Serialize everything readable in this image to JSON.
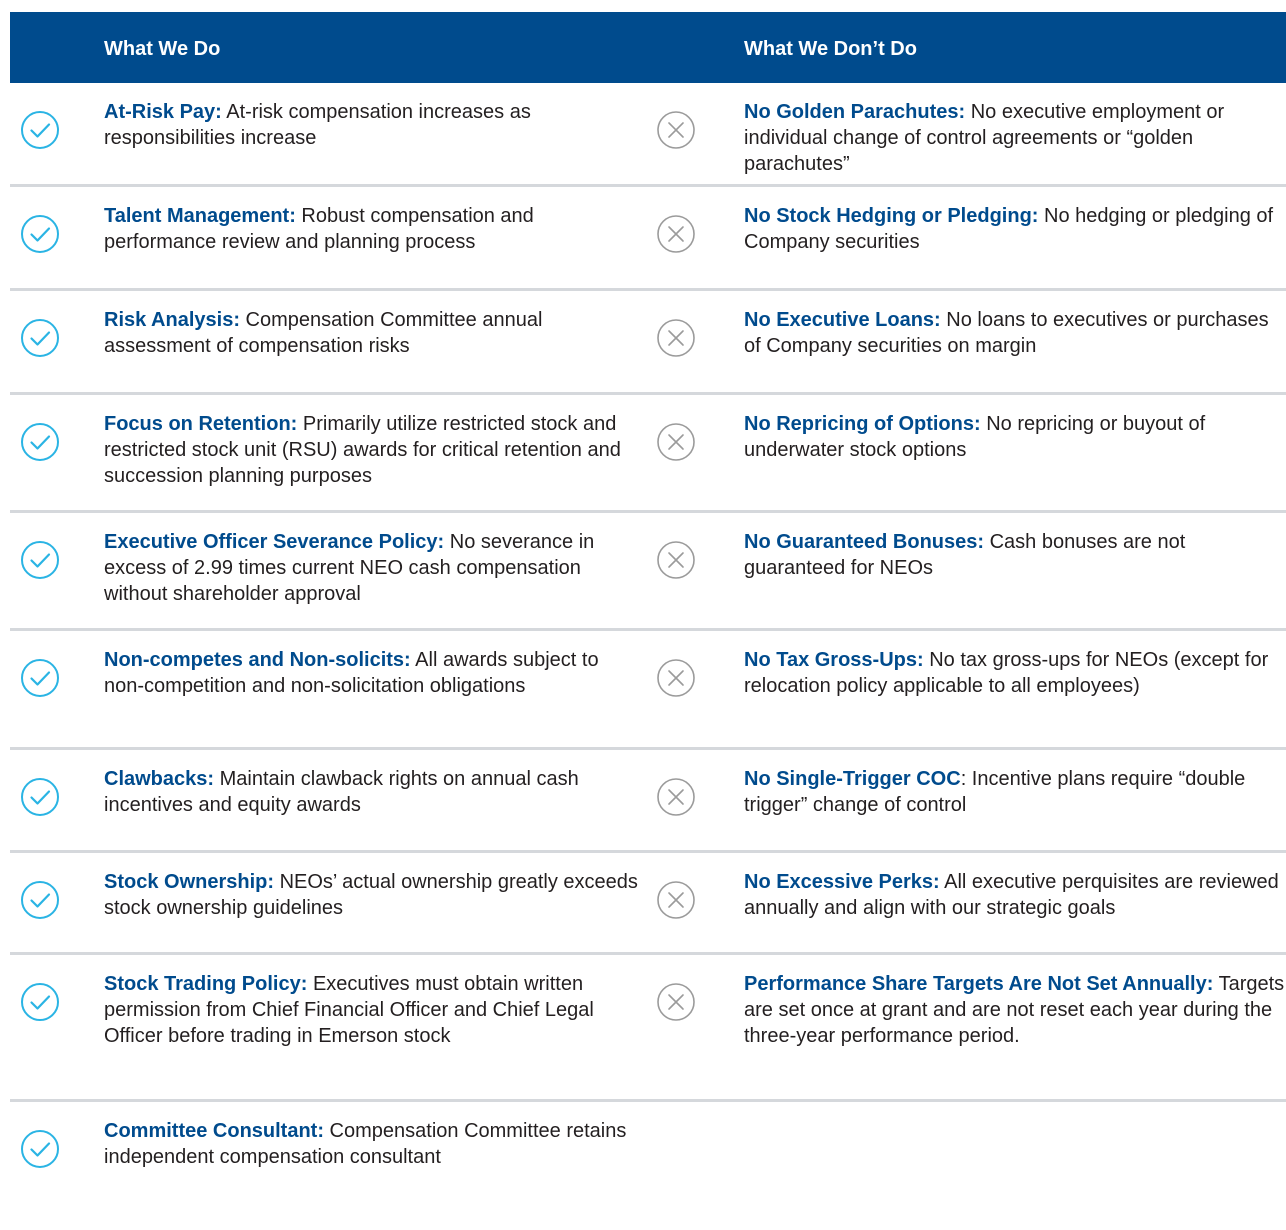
{
  "header": {
    "do_label": "What We Do",
    "dont_label": "What We Don’t Do"
  },
  "colors": {
    "header_bg": "#004b8d",
    "lead_text": "#004b8d",
    "check_icon": "#2ab4e4",
    "x_icon": "#9b9b9b",
    "divider": "#d5d8dc"
  },
  "rows": [
    {
      "do": {
        "title": "At-Risk Pay:",
        "text": " At-risk compensation increases as responsibilities increase"
      },
      "dont": {
        "title": "No Golden Parachutes:",
        "text": " No executive employment or individual change of control agreements or “golden parachutes”"
      }
    },
    {
      "do": {
        "title": "Talent Management:",
        "text": " Robust compensation and performance review and planning process"
      },
      "dont": {
        "title": "No Stock Hedging or Pledging:",
        "text": " No hedging or pledging of Company securities"
      }
    },
    {
      "do": {
        "title": "Risk Analysis:",
        "text": " Compensation Committee annual assessment of compensation risks"
      },
      "dont": {
        "title": "No Executive Loans:",
        "text": " No loans to executives or purchases of Company securities on margin"
      }
    },
    {
      "do": {
        "title": "Focus on Retention:",
        "text": " Primarily utilize restricted stock and restricted stock unit (RSU) awards for critical retention and succession planning purposes"
      },
      "dont": {
        "title": "No Repricing of Options:",
        "text": " No repricing or buyout of underwater stock options"
      }
    },
    {
      "do": {
        "title": "Executive Officer Severance Policy:",
        "text": " No severance in excess of 2.99 times current NEO cash compensation without shareholder approval"
      },
      "dont": {
        "title": "No Guaranteed Bonuses:",
        "text": " Cash bonuses are not guaranteed for NEOs"
      }
    },
    {
      "do": {
        "title": "Non-competes and Non-solicits:",
        "text": " All awards subject to non-competition and non-solicitation obligations"
      },
      "dont": {
        "title": "No Tax Gross-Ups:",
        "text": " No tax gross-ups for NEOs (except for relocation policy applicable to all employees)"
      }
    },
    {
      "do": {
        "title": "Clawbacks:",
        "text": " Maintain clawback rights on annual cash incentives and equity awards"
      },
      "dont": {
        "title": "No Single-Trigger COC",
        "text": ": Incentive plans require “double trigger” change of control"
      }
    },
    {
      "do": {
        "title": "Stock Ownership:",
        "text": " NEOs’ actual ownership greatly exceeds stock ownership guidelines"
      },
      "dont": {
        "title": "No Excessive Perks:",
        "text": " All executive perquisites are reviewed annually and align with our strategic goals"
      }
    },
    {
      "do": {
        "title": "Stock Trading Policy:",
        "text": " Executives must obtain written permission from Chief Financial Officer and Chief Legal Officer before trading in Emerson stock"
      },
      "dont": {
        "title": "Performance Share Targets Are Not Set Annually:",
        "text": " Targets are set once at grant and are not reset each year during the three-year performance period."
      }
    },
    {
      "do": {
        "title": "Committee Consultant:",
        "text": " Compensation Committee retains independent compensation consultant"
      }
    }
  ]
}
